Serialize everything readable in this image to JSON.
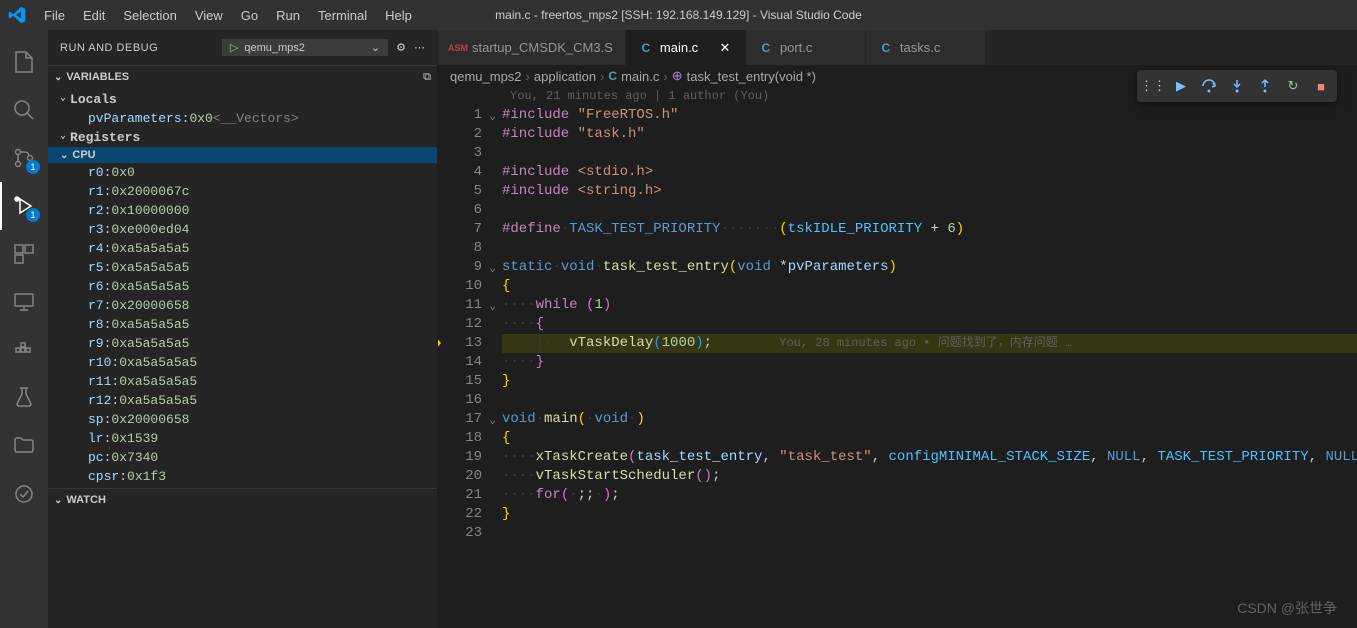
{
  "title": "main.c - freertos_mps2 [SSH: 192.168.149.129] - Visual Studio Code",
  "menu": [
    "File",
    "Edit",
    "Selection",
    "View",
    "Go",
    "Run",
    "Terminal",
    "Help"
  ],
  "sidebar": {
    "title": "RUN AND DEBUG",
    "config": "qemu_mps2",
    "sections": {
      "variables": "VARIABLES",
      "locals": "Locals",
      "registers": "Registers",
      "cpu": "CPU",
      "watch": "WATCH"
    },
    "locals": [
      {
        "name": "pvParameters",
        "value": "0x0",
        "extra": " <__Vectors>"
      }
    ],
    "registers": [
      {
        "name": "r0",
        "value": "0x0"
      },
      {
        "name": "r1",
        "value": "0x2000067c"
      },
      {
        "name": "r2",
        "value": "0x10000000"
      },
      {
        "name": "r3",
        "value": "0xe000ed04"
      },
      {
        "name": "r4",
        "value": "0xa5a5a5a5"
      },
      {
        "name": "r5",
        "value": "0xa5a5a5a5"
      },
      {
        "name": "r6",
        "value": "0xa5a5a5a5"
      },
      {
        "name": "r7",
        "value": "0x20000658"
      },
      {
        "name": "r8",
        "value": "0xa5a5a5a5"
      },
      {
        "name": "r9",
        "value": "0xa5a5a5a5"
      },
      {
        "name": "r10",
        "value": "0xa5a5a5a5"
      },
      {
        "name": "r11",
        "value": "0xa5a5a5a5"
      },
      {
        "name": "r12",
        "value": "0xa5a5a5a5"
      },
      {
        "name": "sp",
        "value": "0x20000658"
      },
      {
        "name": "lr",
        "value": "0x1539"
      },
      {
        "name": "pc",
        "value": "0x7340"
      },
      {
        "name": "cpsr",
        "value": "0x1f3"
      }
    ]
  },
  "tabs": [
    {
      "icon": "asm",
      "label": "startup_CMSDK_CM3.S",
      "active": false
    },
    {
      "icon": "c",
      "label": "main.c",
      "active": true,
      "closable": true
    },
    {
      "icon": "c",
      "label": "port.c",
      "active": false
    },
    {
      "icon": "c",
      "label": "tasks.c",
      "active": false
    }
  ],
  "breadcrumbs": [
    "qemu_mps2",
    "application",
    "main.c",
    "task_test_entry(void *)"
  ],
  "author_line": "You, 21 minutes ago | 1 author (You)",
  "blame": "You, 28 minutes ago • 问题找到了，内存问题 …",
  "code_lines": [
    {
      "n": 1,
      "fold": "v",
      "html": "<span class='kw'>#include</span> <span class='str'>\"FreeRTOS.h\"</span>"
    },
    {
      "n": 2,
      "html": "<span class='kw'>#include</span> <span class='str'>\"task.h\"</span>"
    },
    {
      "n": 3,
      "html": ""
    },
    {
      "n": 4,
      "html": "<span class='kw'>#include</span> <span class='str'>&lt;stdio.h&gt;</span>"
    },
    {
      "n": 5,
      "html": "<span class='kw'>#include</span> <span class='str'>&lt;string.h&gt;</span>"
    },
    {
      "n": 6,
      "html": ""
    },
    {
      "n": 7,
      "html": "<span class='kw'>#define</span><span class='ws'>·</span><span class='macro'>TASK_TEST_PRIORITY</span><span class='ws'>·······</span><span class='paren2'>(</span><span class='const'>tskIDLE_PRIORITY</span> <span>+</span> <span class='num'>6</span><span class='paren2'>)</span>"
    },
    {
      "n": 8,
      "html": ""
    },
    {
      "n": 9,
      "fold": "v",
      "html": "<span class='type'>static</span><span class='ws'>·</span><span class='type'>void</span><span class='ws'>·</span><span class='func'>task_test_entry</span><span class='paren2'>(</span><span class='type'>void</span> <span>*</span><span class='ident'>pvParameters</span><span class='paren2'>)</span>"
    },
    {
      "n": 10,
      "html": "<span class='paren2'>{</span>"
    },
    {
      "n": 11,
      "fold": "v",
      "html": "<span class='ws'>····</span><span class='kw'>while</span> <span class='paren'>(</span><span class='num'>1</span><span class='paren'>)</span>"
    },
    {
      "n": 12,
      "html": "<span class='ws'>····</span><span class='paren'>{</span>"
    },
    {
      "n": 13,
      "hl": true,
      "bp": true,
      "html": "<span class='ws'>····│···</span><span class='func'>vTaskDelay</span><span class='paren3'>(</span><span class='num'>1000</span><span class='paren3'>)</span>;"
    },
    {
      "n": 14,
      "html": "<span class='ws'>····</span><span class='paren'>}</span>"
    },
    {
      "n": 15,
      "html": "<span class='paren2'>}</span>"
    },
    {
      "n": 16,
      "html": ""
    },
    {
      "n": 17,
      "fold": "v",
      "html": "<span class='type'>void</span><span class='ws'>·</span><span class='func'>main</span><span class='paren2'>(</span><span class='ws'>·</span><span class='type'>void</span><span class='ws'>·</span><span class='paren2'>)</span>"
    },
    {
      "n": 18,
      "html": "<span class='paren2'>{</span>"
    },
    {
      "n": 19,
      "html": "<span class='ws'>····</span><span class='func'>xTaskCreate</span><span class='paren'>(</span><span class='ident'>task_test_entry</span>, <span class='str'>\"task_test\"</span>, <span class='const'>configMINIMAL_STACK_SIZE</span>, <span class='macro'>NULL</span>, <span class='const'>TASK_TEST_PRIORITY</span>, <span class='macro'>NULL</span><span class='paren'>)</span>;"
    },
    {
      "n": 20,
      "html": "<span class='ws'>····</span><span class='func'>vTaskStartScheduler</span><span class='paren'>(</span><span class='paren'>)</span>;"
    },
    {
      "n": 21,
      "html": "<span class='ws'>····</span><span class='kw'>for</span><span class='paren'>(</span><span class='ws'>·</span>;;<span class='ws'>·</span><span class='paren'>)</span>;"
    },
    {
      "n": 22,
      "html": "<span class='paren2'>}</span>"
    },
    {
      "n": 23,
      "html": ""
    }
  ],
  "watermark": "CSDN @张世争",
  "badges": {
    "scm": "1",
    "debug": "1"
  }
}
